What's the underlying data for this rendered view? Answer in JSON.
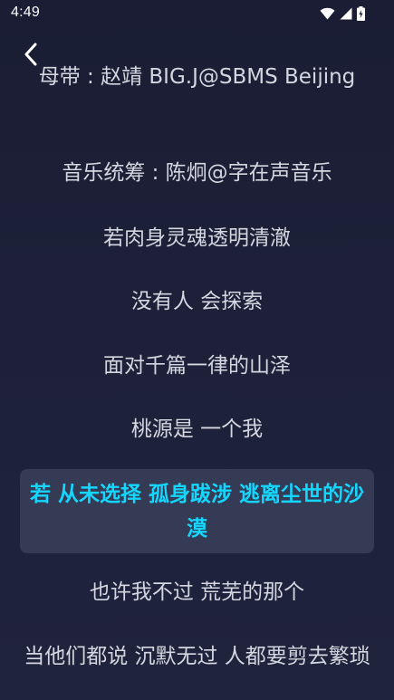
{
  "status_bar": {
    "time": "4:49",
    "icons": [
      "wifi-icon",
      "cellular-signal-icon",
      "battery-charging-icon"
    ]
  },
  "header": {
    "back_icon": "chevron-left-icon"
  },
  "lyrics": [
    {
      "text": "母带 : 赵靖 BIG.J@SBMS Beijing",
      "active": false
    },
    {
      "text": "音乐统筹 : 陈炯@字在声音乐",
      "active": false
    },
    {
      "text": "若肉身灵魂透明清澈",
      "active": false
    },
    {
      "text": "没有人 会探索",
      "active": false
    },
    {
      "text": "面对千篇一律的山泽",
      "active": false
    },
    {
      "text": "桃源是 一个我",
      "active": false
    },
    {
      "text": "若 从未选择 孤身跋涉 逃离尘世的沙漠",
      "active": true
    },
    {
      "text": "也许我不过 荒芜的那个",
      "active": false
    },
    {
      "text": "当他们都说 沉默无过 人都要剪去繁琐",
      "active": false
    }
  ],
  "colors": {
    "background": "#1c1f36",
    "lyric_text": "#d4d6e0",
    "active_text": "#14d7ff",
    "active_bg": "#353a55"
  }
}
